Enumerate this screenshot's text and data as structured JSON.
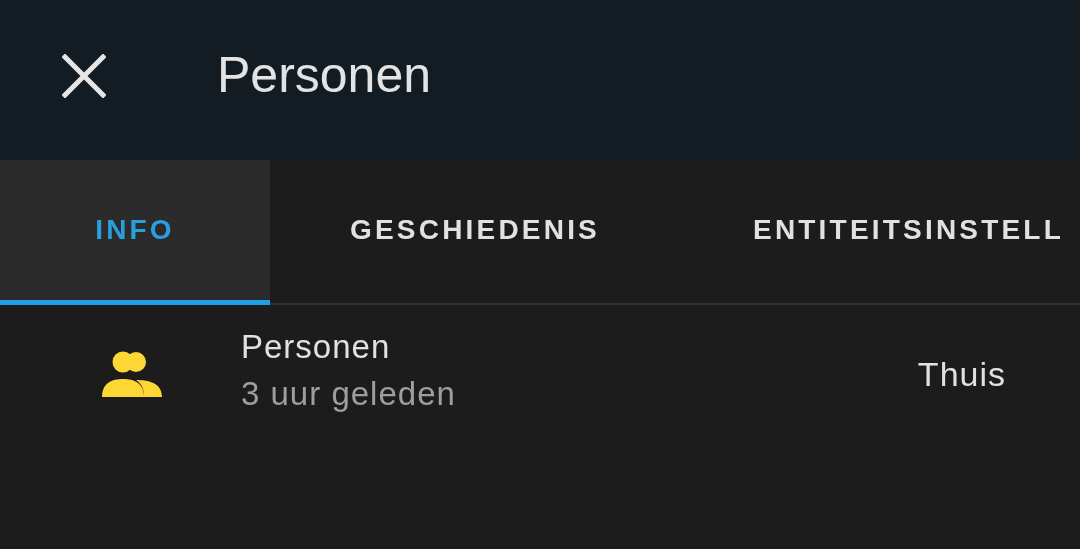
{
  "window": {
    "title": "Personen"
  },
  "tabs": [
    {
      "label": "INFO",
      "selected": true
    },
    {
      "label": "GESCHIEDENIS",
      "selected": false
    },
    {
      "label": "ENTITEITSINSTELL",
      "selected": false
    }
  ],
  "entity": {
    "name": "Personen",
    "last_changed": "3 uur geleden",
    "state": "Thuis"
  }
}
